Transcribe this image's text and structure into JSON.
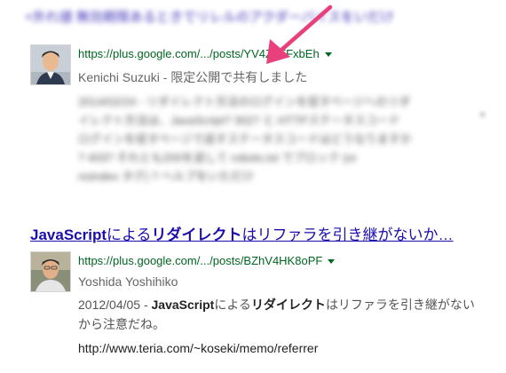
{
  "results": [
    {
      "title": "+外れ値 無効期限あるときでリレルのアクダーバイスをいだけ",
      "url": "https://plus.google.com/.../posts/YV4Z2FFxbEh",
      "author": "Kenichi Suzuki - 限定公開で共有しました",
      "snippet_blurred": [
        "2014/02/24 - リダイレクト方法のログインを促すページへのリダ",
        "イレクト方法は、JavaScript? 302? と HTTPステータスコード",
        "ログインを促すページで返すステータスコードはどうなりますか",
        "? 403? それとも200を返して robots.txt でブロック (or",
        "noindex タグ) ? ヘルプをいただけ"
      ]
    },
    {
      "title_parts": [
        {
          "text": "JavaScript",
          "bold": true
        },
        {
          "text": "による",
          "bold": false
        },
        {
          "text": "リダイレクト",
          "bold": true
        },
        {
          "text": "はリファラを引き継がないか",
          "bold": false
        }
      ],
      "title_ellipsis": "…",
      "url": "https://plus.google.com/.../posts/BZhV4HK8oPF",
      "author": "Yoshida Yoshihiko",
      "snippet_parts": [
        {
          "text": "2012/04/05 - ",
          "bold": false
        },
        {
          "text": "JavaScript",
          "bold": true
        },
        {
          "text": "による",
          "bold": false
        },
        {
          "text": "リダイレクト",
          "bold": true
        },
        {
          "text": "はリファラを引き継がないから注意だね。",
          "bold": false
        }
      ],
      "link": "http://www.teria.com/~koseki/memo/referrer"
    }
  ],
  "colors": {
    "link": "#1a0dab",
    "url": "#006621",
    "author": "#666666",
    "snippet": "#545454",
    "arrow": "#e8407a"
  },
  "icons": {
    "avatar_1": "avatar-kenichi-suzuki",
    "avatar_2": "avatar-yoshida-yoshihiko",
    "dropdown": "caret-down-icon",
    "annotation": "arrow-pointer"
  }
}
